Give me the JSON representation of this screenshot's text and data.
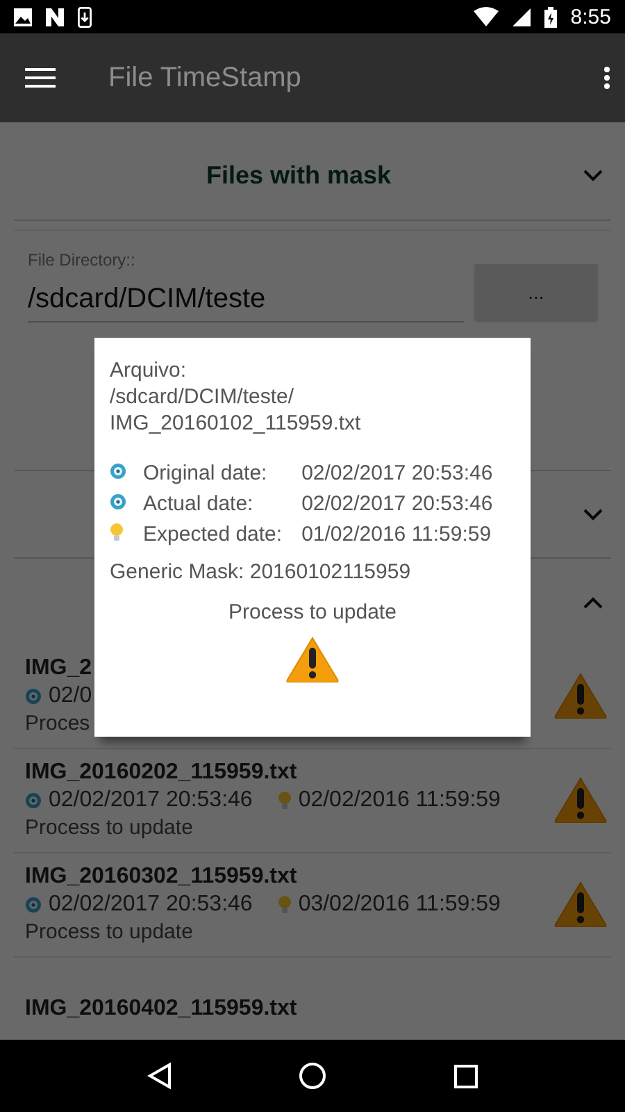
{
  "status_bar": {
    "time": "8:55"
  },
  "app_bar": {
    "title": "File TimeStamp"
  },
  "sections": [
    {
      "title": "Files with mask",
      "expanded": false
    },
    {
      "expanded": false
    },
    {
      "expanded": true
    }
  ],
  "directory": {
    "label": "File Directory::",
    "value": "/sdcard/DCIM/teste",
    "button": "..."
  },
  "files": [
    {
      "name": "IMG_2",
      "dates": [
        {
          "kind": "clock",
          "value": "02/0"
        }
      ],
      "status": "Proces"
    },
    {
      "name": "IMG_20160202_115959.txt",
      "dates": [
        {
          "kind": "clock",
          "value": "02/02/2017 20:53:46"
        },
        {
          "kind": "bulb",
          "value": "02/02/2016 11:59:59"
        }
      ],
      "status": "Process to update"
    },
    {
      "name": "IMG_20160302_115959.txt",
      "dates": [
        {
          "kind": "clock",
          "value": "02/02/2017 20:53:46"
        },
        {
          "kind": "bulb",
          "value": "03/02/2016 11:59:59"
        }
      ],
      "status": "Process to update"
    },
    {
      "name": "IMG_20160402_115959.txt"
    }
  ],
  "dialog": {
    "file_label": "Arquivo:",
    "path": "/sdcard/DCIM/teste/\nIMG_20160102_115959.txt",
    "dates": [
      {
        "kind": "clock",
        "label": "Original date:",
        "value": "02/02/2017 20:53:46"
      },
      {
        "kind": "clock",
        "label": "Actual date:",
        "value": "02/02/2017 20:53:46"
      },
      {
        "kind": "bulb",
        "label": "Expected date:",
        "value": "01/02/2016 11:59:59"
      }
    ],
    "mask": "Generic Mask: 20160102115959",
    "status": "Process to update"
  }
}
